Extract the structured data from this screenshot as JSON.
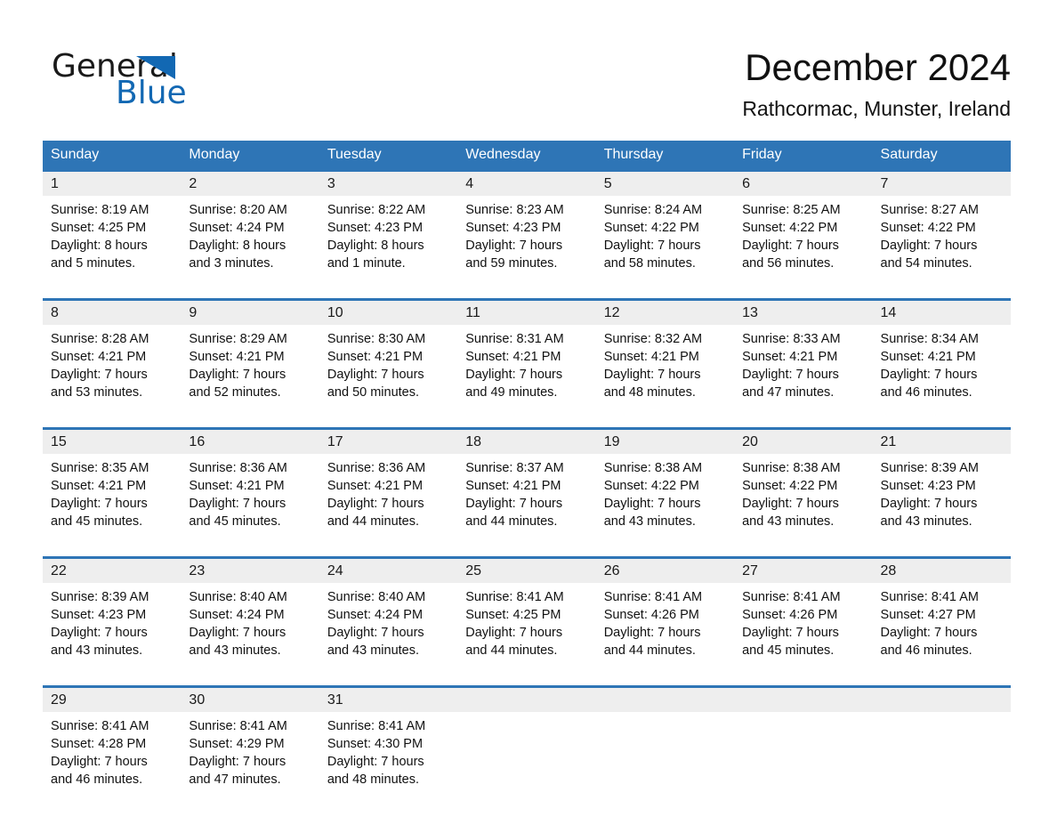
{
  "brand": {
    "name_part1": "General",
    "name_part2": "Blue",
    "accent_color": "#1268b3",
    "triangle_icon": "brand-triangle-icon"
  },
  "header": {
    "title": "December 2024",
    "subtitle": "Rathcormac, Munster, Ireland"
  },
  "calendar": {
    "header_color": "#2e75b6",
    "daynum_band_color": "#eeeeee",
    "weekdays": [
      "Sunday",
      "Monday",
      "Tuesday",
      "Wednesday",
      "Thursday",
      "Friday",
      "Saturday"
    ],
    "weeks": [
      {
        "days": [
          {
            "num": "1",
            "sunrise": "Sunrise: 8:19 AM",
            "sunset": "Sunset: 4:25 PM",
            "daylight_1": "Daylight: 8 hours",
            "daylight_2": "and 5 minutes."
          },
          {
            "num": "2",
            "sunrise": "Sunrise: 8:20 AM",
            "sunset": "Sunset: 4:24 PM",
            "daylight_1": "Daylight: 8 hours",
            "daylight_2": "and 3 minutes."
          },
          {
            "num": "3",
            "sunrise": "Sunrise: 8:22 AM",
            "sunset": "Sunset: 4:23 PM",
            "daylight_1": "Daylight: 8 hours",
            "daylight_2": "and 1 minute."
          },
          {
            "num": "4",
            "sunrise": "Sunrise: 8:23 AM",
            "sunset": "Sunset: 4:23 PM",
            "daylight_1": "Daylight: 7 hours",
            "daylight_2": "and 59 minutes."
          },
          {
            "num": "5",
            "sunrise": "Sunrise: 8:24 AM",
            "sunset": "Sunset: 4:22 PM",
            "daylight_1": "Daylight: 7 hours",
            "daylight_2": "and 58 minutes."
          },
          {
            "num": "6",
            "sunrise": "Sunrise: 8:25 AM",
            "sunset": "Sunset: 4:22 PM",
            "daylight_1": "Daylight: 7 hours",
            "daylight_2": "and 56 minutes."
          },
          {
            "num": "7",
            "sunrise": "Sunrise: 8:27 AM",
            "sunset": "Sunset: 4:22 PM",
            "daylight_1": "Daylight: 7 hours",
            "daylight_2": "and 54 minutes."
          }
        ]
      },
      {
        "days": [
          {
            "num": "8",
            "sunrise": "Sunrise: 8:28 AM",
            "sunset": "Sunset: 4:21 PM",
            "daylight_1": "Daylight: 7 hours",
            "daylight_2": "and 53 minutes."
          },
          {
            "num": "9",
            "sunrise": "Sunrise: 8:29 AM",
            "sunset": "Sunset: 4:21 PM",
            "daylight_1": "Daylight: 7 hours",
            "daylight_2": "and 52 minutes."
          },
          {
            "num": "10",
            "sunrise": "Sunrise: 8:30 AM",
            "sunset": "Sunset: 4:21 PM",
            "daylight_1": "Daylight: 7 hours",
            "daylight_2": "and 50 minutes."
          },
          {
            "num": "11",
            "sunrise": "Sunrise: 8:31 AM",
            "sunset": "Sunset: 4:21 PM",
            "daylight_1": "Daylight: 7 hours",
            "daylight_2": "and 49 minutes."
          },
          {
            "num": "12",
            "sunrise": "Sunrise: 8:32 AM",
            "sunset": "Sunset: 4:21 PM",
            "daylight_1": "Daylight: 7 hours",
            "daylight_2": "and 48 minutes."
          },
          {
            "num": "13",
            "sunrise": "Sunrise: 8:33 AM",
            "sunset": "Sunset: 4:21 PM",
            "daylight_1": "Daylight: 7 hours",
            "daylight_2": "and 47 minutes."
          },
          {
            "num": "14",
            "sunrise": "Sunrise: 8:34 AM",
            "sunset": "Sunset: 4:21 PM",
            "daylight_1": "Daylight: 7 hours",
            "daylight_2": "and 46 minutes."
          }
        ]
      },
      {
        "days": [
          {
            "num": "15",
            "sunrise": "Sunrise: 8:35 AM",
            "sunset": "Sunset: 4:21 PM",
            "daylight_1": "Daylight: 7 hours",
            "daylight_2": "and 45 minutes."
          },
          {
            "num": "16",
            "sunrise": "Sunrise: 8:36 AM",
            "sunset": "Sunset: 4:21 PM",
            "daylight_1": "Daylight: 7 hours",
            "daylight_2": "and 45 minutes."
          },
          {
            "num": "17",
            "sunrise": "Sunrise: 8:36 AM",
            "sunset": "Sunset: 4:21 PM",
            "daylight_1": "Daylight: 7 hours",
            "daylight_2": "and 44 minutes."
          },
          {
            "num": "18",
            "sunrise": "Sunrise: 8:37 AM",
            "sunset": "Sunset: 4:21 PM",
            "daylight_1": "Daylight: 7 hours",
            "daylight_2": "and 44 minutes."
          },
          {
            "num": "19",
            "sunrise": "Sunrise: 8:38 AM",
            "sunset": "Sunset: 4:22 PM",
            "daylight_1": "Daylight: 7 hours",
            "daylight_2": "and 43 minutes."
          },
          {
            "num": "20",
            "sunrise": "Sunrise: 8:38 AM",
            "sunset": "Sunset: 4:22 PM",
            "daylight_1": "Daylight: 7 hours",
            "daylight_2": "and 43 minutes."
          },
          {
            "num": "21",
            "sunrise": "Sunrise: 8:39 AM",
            "sunset": "Sunset: 4:23 PM",
            "daylight_1": "Daylight: 7 hours",
            "daylight_2": "and 43 minutes."
          }
        ]
      },
      {
        "days": [
          {
            "num": "22",
            "sunrise": "Sunrise: 8:39 AM",
            "sunset": "Sunset: 4:23 PM",
            "daylight_1": "Daylight: 7 hours",
            "daylight_2": "and 43 minutes."
          },
          {
            "num": "23",
            "sunrise": "Sunrise: 8:40 AM",
            "sunset": "Sunset: 4:24 PM",
            "daylight_1": "Daylight: 7 hours",
            "daylight_2": "and 43 minutes."
          },
          {
            "num": "24",
            "sunrise": "Sunrise: 8:40 AM",
            "sunset": "Sunset: 4:24 PM",
            "daylight_1": "Daylight: 7 hours",
            "daylight_2": "and 43 minutes."
          },
          {
            "num": "25",
            "sunrise": "Sunrise: 8:41 AM",
            "sunset": "Sunset: 4:25 PM",
            "daylight_1": "Daylight: 7 hours",
            "daylight_2": "and 44 minutes."
          },
          {
            "num": "26",
            "sunrise": "Sunrise: 8:41 AM",
            "sunset": "Sunset: 4:26 PM",
            "daylight_1": "Daylight: 7 hours",
            "daylight_2": "and 44 minutes."
          },
          {
            "num": "27",
            "sunrise": "Sunrise: 8:41 AM",
            "sunset": "Sunset: 4:26 PM",
            "daylight_1": "Daylight: 7 hours",
            "daylight_2": "and 45 minutes."
          },
          {
            "num": "28",
            "sunrise": "Sunrise: 8:41 AM",
            "sunset": "Sunset: 4:27 PM",
            "daylight_1": "Daylight: 7 hours",
            "daylight_2": "and 46 minutes."
          }
        ]
      },
      {
        "days": [
          {
            "num": "29",
            "sunrise": "Sunrise: 8:41 AM",
            "sunset": "Sunset: 4:28 PM",
            "daylight_1": "Daylight: 7 hours",
            "daylight_2": "and 46 minutes."
          },
          {
            "num": "30",
            "sunrise": "Sunrise: 8:41 AM",
            "sunset": "Sunset: 4:29 PM",
            "daylight_1": "Daylight: 7 hours",
            "daylight_2": "and 47 minutes."
          },
          {
            "num": "31",
            "sunrise": "Sunrise: 8:41 AM",
            "sunset": "Sunset: 4:30 PM",
            "daylight_1": "Daylight: 7 hours",
            "daylight_2": "and 48 minutes."
          },
          {
            "num": "",
            "sunrise": "",
            "sunset": "",
            "daylight_1": "",
            "daylight_2": ""
          },
          {
            "num": "",
            "sunrise": "",
            "sunset": "",
            "daylight_1": "",
            "daylight_2": ""
          },
          {
            "num": "",
            "sunrise": "",
            "sunset": "",
            "daylight_1": "",
            "daylight_2": ""
          },
          {
            "num": "",
            "sunrise": "",
            "sunset": "",
            "daylight_1": "",
            "daylight_2": ""
          }
        ]
      }
    ]
  }
}
